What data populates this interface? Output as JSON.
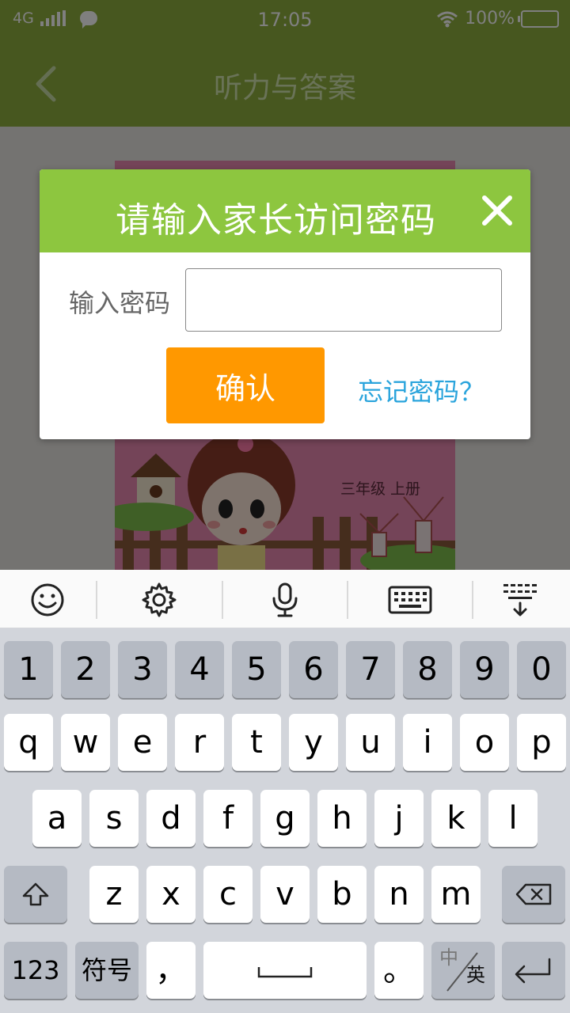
{
  "status_bar": {
    "network": "4G",
    "time": "17:05",
    "battery": "100%"
  },
  "nav": {
    "title": "听力与答案"
  },
  "cover": {
    "grade_text": "三年级 上册"
  },
  "dialog": {
    "title": "请输入家长访问密码",
    "password_label": "输入密码",
    "password_value": "",
    "password_placeholder": "",
    "confirm_label": "确认",
    "forgot_label": "忘记密码？"
  },
  "keyboard": {
    "toolbar_icons": [
      "emoji-icon",
      "settings-icon",
      "microphone-icon",
      "keyboard-icon",
      "collapse-keyboard-icon"
    ],
    "row_numbers": [
      "1",
      "2",
      "3",
      "4",
      "5",
      "6",
      "7",
      "8",
      "9",
      "0"
    ],
    "row1": [
      "q",
      "w",
      "e",
      "r",
      "t",
      "y",
      "u",
      "i",
      "o",
      "p"
    ],
    "row2": [
      "a",
      "s",
      "d",
      "f",
      "g",
      "h",
      "j",
      "k",
      "l"
    ],
    "row3": [
      "z",
      "x",
      "c",
      "v",
      "b",
      "n",
      "m"
    ],
    "mode_123": "123",
    "symbols": "符号",
    "comma": "，",
    "period": "。",
    "lang_top": "中",
    "lang_bottom": "英"
  },
  "colors": {
    "header_green": "#8eaf3f",
    "dialog_green": "#8dc63f",
    "confirm_orange": "#ff9800",
    "link_blue": "#2aa4dc"
  }
}
